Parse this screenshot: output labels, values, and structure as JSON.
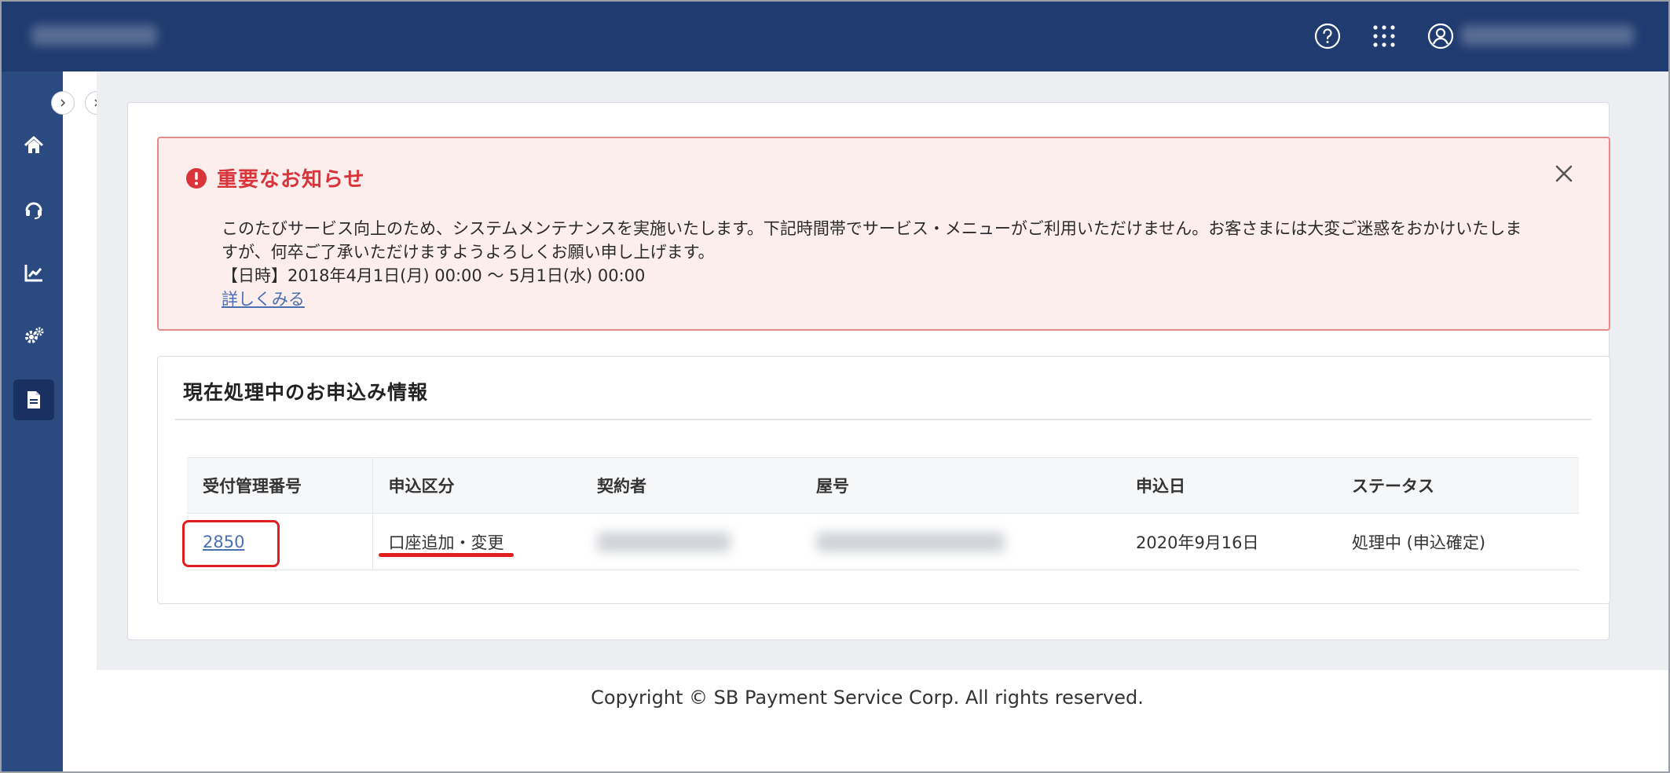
{
  "colors": {
    "header": "#203b70",
    "sidebar": "#2a4a80",
    "alert_bg": "#fdeeee",
    "alert_border": "#e98a8a",
    "alert_title": "#d8343a",
    "link": "#4a6fb3",
    "highlight": "#e02020"
  },
  "header": {
    "icons": [
      "help-circle-icon",
      "apps-grid-icon",
      "user-circle-icon"
    ]
  },
  "sidebar": {
    "items": [
      {
        "icon": "home-icon"
      },
      {
        "icon": "headset-icon"
      },
      {
        "icon": "chart-icon"
      },
      {
        "icon": "gears-icon"
      },
      {
        "icon": "document-icon",
        "active": true
      }
    ]
  },
  "alert": {
    "title": "重要なお知らせ",
    "line1": "このたびサービス向上のため、システムメンテナンスを実施いたします。下記時間帯でサービス・メニューがご利用いただけません。お客さまには大変ご迷惑をおかけいたしま",
    "line2": "すが、何卒ご了承いただけますようよろしくお願い申し上げます。",
    "line3": "【日時】2018年4月1日(月) 00:00 〜 5月1日(水) 00:00",
    "link": "詳しくみる"
  },
  "applications": {
    "title": "現在処理中のお申込み情報",
    "columns": [
      "受付管理番号",
      "申込区分",
      "契約者",
      "屋号",
      "申込日",
      "ステータス"
    ],
    "rows": [
      {
        "id": "2850",
        "type": "口座追加・変更",
        "date": "2020年9月16日",
        "status": "処理中 (申込確定)"
      }
    ]
  },
  "footer": {
    "copyright": "Copyright © SB Payment Service Corp. All rights reserved."
  }
}
